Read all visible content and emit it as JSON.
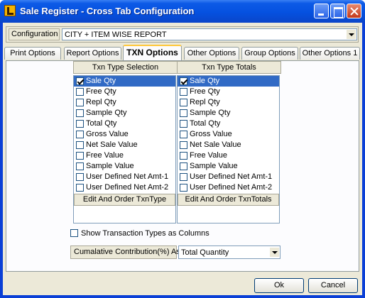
{
  "window": {
    "title": "Sale Register - Cross Tab Configuration",
    "buttons": [
      "minimize",
      "maximize",
      "close"
    ]
  },
  "configuration": {
    "label": "Configuration",
    "value": "CITY + ITEM WISE REPORT"
  },
  "tabs": [
    {
      "label": "Print Options",
      "active": false
    },
    {
      "label": "Report Options",
      "active": false
    },
    {
      "label": "TXN Options",
      "active": true
    },
    {
      "label": "Other Options",
      "active": false
    },
    {
      "label": "Group Options",
      "active": false
    },
    {
      "label": "Other Options 1",
      "active": false
    }
  ],
  "txn_type_selection": {
    "header": "Txn Type Selection",
    "items": [
      {
        "label": "Sale Qty",
        "checked": true,
        "selected": true
      },
      {
        "label": "Free Qty",
        "checked": false,
        "selected": false
      },
      {
        "label": "Repl Qty",
        "checked": false,
        "selected": false
      },
      {
        "label": "Sample Qty",
        "checked": false,
        "selected": false
      },
      {
        "label": "Total Qty",
        "checked": false,
        "selected": false
      },
      {
        "label": "Gross Value",
        "checked": false,
        "selected": false
      },
      {
        "label": "Net Sale Value",
        "checked": false,
        "selected": false
      },
      {
        "label": "Free Value",
        "checked": false,
        "selected": false
      },
      {
        "label": "Sample Value",
        "checked": false,
        "selected": false
      },
      {
        "label": "User Defined Net Amt-1",
        "checked": false,
        "selected": false
      },
      {
        "label": "User Defined Net Amt-2",
        "checked": false,
        "selected": false
      }
    ],
    "button": "Edit And Order TxnType"
  },
  "txn_type_totals": {
    "header": "Txn Type Totals",
    "items": [
      {
        "label": "Sale Qty",
        "checked": true,
        "selected": true
      },
      {
        "label": "Free Qty",
        "checked": false,
        "selected": false
      },
      {
        "label": "Repl Qty",
        "checked": false,
        "selected": false
      },
      {
        "label": "Sample Qty",
        "checked": false,
        "selected": false
      },
      {
        "label": "Total Qty",
        "checked": false,
        "selected": false
      },
      {
        "label": "Gross Value",
        "checked": false,
        "selected": false
      },
      {
        "label": "Net Sale Value",
        "checked": false,
        "selected": false
      },
      {
        "label": "Free Value",
        "checked": false,
        "selected": false
      },
      {
        "label": "Sample Value",
        "checked": false,
        "selected": false
      },
      {
        "label": "User Defined Net Amt-1",
        "checked": false,
        "selected": false
      },
      {
        "label": "User Defined Net Amt-2",
        "checked": false,
        "selected": false
      }
    ],
    "button": "Edit And Order TxnTotals"
  },
  "show_transaction_types": {
    "label": "Show Transaction Types as Columns",
    "checked": false
  },
  "cumulative": {
    "label": "Cumalative Contribution(%) As",
    "value": "Total Quantity"
  },
  "footer": {
    "ok": "Ok",
    "cancel": "Cancel"
  },
  "colors": {
    "title_bar": "#0551e0",
    "selection": "#316ac5",
    "face": "#ece9d8",
    "active_tab_accent": "#ffc83c"
  }
}
